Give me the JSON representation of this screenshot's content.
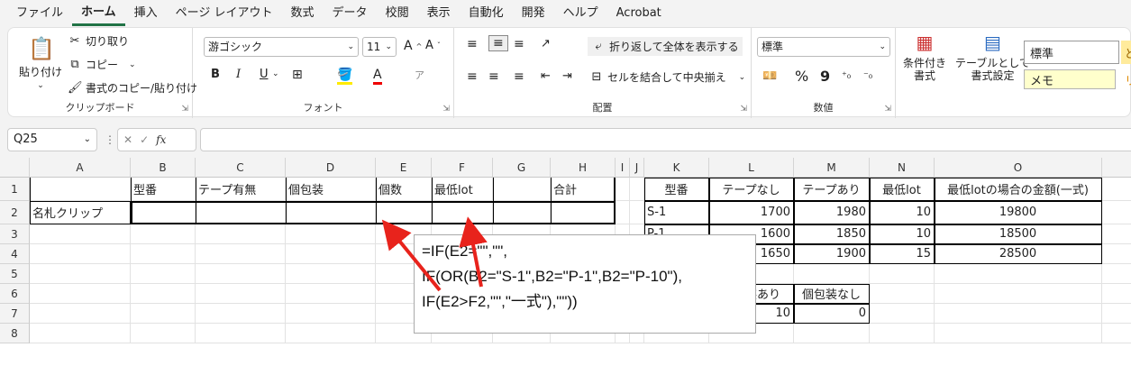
{
  "menu": [
    "ファイル",
    "ホーム",
    "挿入",
    "ページ レイアウト",
    "数式",
    "データ",
    "校閲",
    "表示",
    "自動化",
    "開発",
    "ヘルプ",
    "Acrobat"
  ],
  "ribbon": {
    "clipboard": {
      "paste": "貼り付け",
      "cut": "切り取り",
      "copy": "コピー",
      "format_painter": "書式のコピー/貼り付け",
      "label": "クリップボード"
    },
    "font": {
      "name": "游ゴシック",
      "size": "11",
      "grow": "A^",
      "shrink": "Aˇ",
      "bold": "B",
      "italic": "I",
      "underline": "U",
      "label": "フォント"
    },
    "align": {
      "wrap": "折り返して全体を表示する",
      "merge": "セルを結合して中央揃え",
      "label": "配置"
    },
    "number": {
      "format": "標準",
      "percent": "%",
      "comma": "9",
      "label": "数値"
    },
    "styles": {
      "cond": "条件付き",
      "cond2": "書式",
      "table": "テーブルとして",
      "table2": "書式設定",
      "std": "標準",
      "memo": "メモ",
      "good": "ど",
      "bad": "リ"
    }
  },
  "namebox": "Q25",
  "fx": "fx",
  "columns": [
    "A",
    "B",
    "C",
    "D",
    "E",
    "F",
    "G",
    "H",
    "I",
    "J",
    "K",
    "L",
    "M",
    "N",
    "O",
    "P"
  ],
  "rows": [
    "1",
    "2",
    "3",
    "4",
    "5",
    "6",
    "7",
    "8"
  ],
  "cells": {
    "B1": "型番",
    "C1": "テープ有無",
    "D1": "個包装",
    "E1": "個数",
    "F1": "最低lot",
    "H1": "合計",
    "A2": "名札クリップ",
    "K1": "型番",
    "L1": "テープなし",
    "M1": "テープあり",
    "N1": "最低lot",
    "O1": "最低lotの場合の金額(一式)",
    "K2": "S-1",
    "L2": "1700",
    "M2": "1980",
    "N2": "10",
    "O2": "19800",
    "K3": "P-1",
    "L3": "1600",
    "M3": "1850",
    "N3": "10",
    "O3": "18500",
    "K4": "P-10",
    "L4": "1650",
    "M4": "1900",
    "N4": "15",
    "O4": "28500",
    "L6": "個包装あり",
    "M6": "個包装なし",
    "L7": "10",
    "M7": "0"
  },
  "callout": [
    "=IF(E2=\"\",\"\",",
    "IF(OR(B2=\"S-1\",B2=\"P-1\",B2=\"P-10\"),",
    "IF(E2>F2,\"\",\"一式\"),\"\"))"
  ],
  "colors": {
    "accent": "#217346",
    "arrow": "#e8231c"
  }
}
